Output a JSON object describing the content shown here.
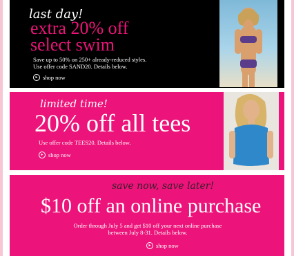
{
  "banners": [
    {
      "script": "last day!",
      "headline_1": "extra 20% off",
      "headline_2": "select swim",
      "body_1": "Save up to 50% on 250+ already-reduced styles.",
      "body_2": "Use offer code SAND20. Details below.",
      "cta": "shop now"
    },
    {
      "script": "limited time!",
      "headline": "20% off all tees",
      "body": "Use offer code TEES20. Details below.",
      "cta": "shop now"
    },
    {
      "script": "save now, save later!",
      "headline": "$10 off an online purchase",
      "body_1": "Order through July 5 and get $10 off your next online purchase",
      "body_2": "between July 8-31. Details below.",
      "cta": "shop now"
    }
  ],
  "colors": {
    "pink": "#ec147a",
    "black": "#000000",
    "page_bg": "#f6c6d4"
  },
  "icons": {
    "cta": "play-circle-icon"
  }
}
